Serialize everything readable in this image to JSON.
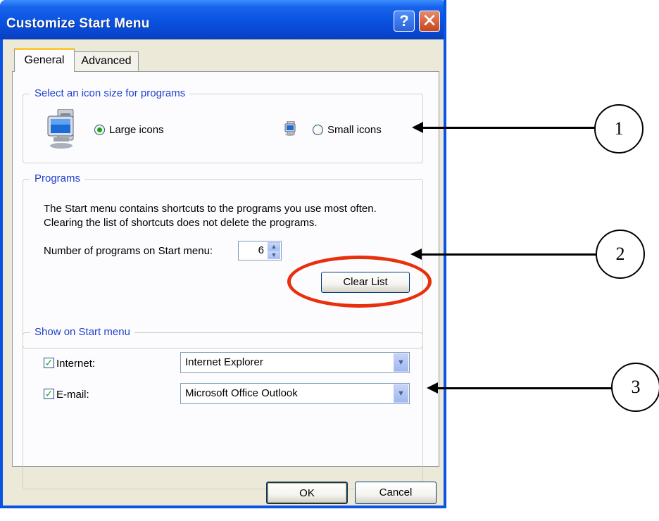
{
  "window": {
    "title": "Customize Start Menu"
  },
  "title_buttons": {
    "help": "?",
    "close": "✕"
  },
  "tabs": [
    {
      "label": "General",
      "selected": true
    },
    {
      "label": "Advanced",
      "selected": false
    }
  ],
  "icon_size": {
    "legend": "Select an icon size for programs",
    "large_label": "Large icons",
    "small_label": "Small icons",
    "selected": "Large icons"
  },
  "programs": {
    "legend": "Programs",
    "description_line1": "The Start menu contains shortcuts to the programs you use most often.",
    "description_line2": "Clearing the list of shortcuts does not delete the programs.",
    "count_label": "Number of programs on Start menu:",
    "count_value": "6",
    "clear_button": "Clear List"
  },
  "show_on_start": {
    "legend": "Show on Start menu",
    "internet_label": "Internet:",
    "internet_checked": true,
    "internet_value": "Internet Explorer",
    "email_label": "E-mail:",
    "email_checked": true,
    "email_value": "Microsoft Office Outlook"
  },
  "footer": {
    "ok": "OK",
    "cancel": "Cancel"
  },
  "annotations": [
    "1",
    "2",
    "3"
  ],
  "colors": {
    "title_bar": "#0a54e3",
    "highlight_ring": "#e8300d",
    "group_legend": "#1f3fcc"
  }
}
